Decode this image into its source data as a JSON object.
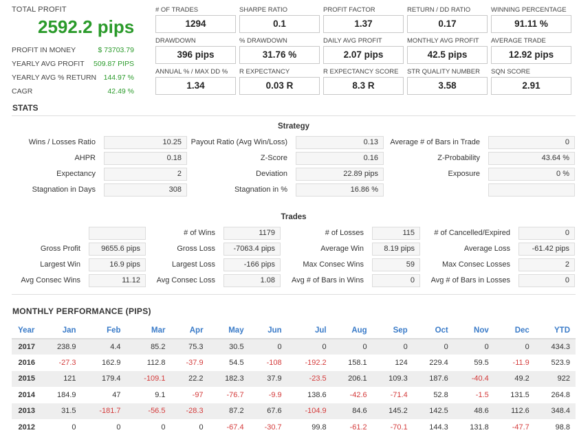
{
  "summary": {
    "total_label": "TOTAL PROFIT",
    "total_value": "2592.2 pips",
    "rows": [
      {
        "label": "PROFIT IN MONEY",
        "value": "$ 73703.79"
      },
      {
        "label": "YEARLY AVG PROFIT",
        "value": "509.87 PIPS"
      },
      {
        "label": "YEARLY AVG % RETURN",
        "value": "144.97 %"
      },
      {
        "label": "CAGR",
        "value": "42.49 %"
      }
    ]
  },
  "metrics": [
    {
      "label": "# OF TRADES",
      "value": "1294"
    },
    {
      "label": "SHARPE RATIO",
      "value": "0.1"
    },
    {
      "label": "PROFIT FACTOR",
      "value": "1.37"
    },
    {
      "label": "RETURN / DD RATIO",
      "value": "0.17"
    },
    {
      "label": "WINNING PERCENTAGE",
      "value": "91.11 %"
    },
    {
      "label": "DRAWDOWN",
      "value": "396 pips"
    },
    {
      "label": "% DRAWDOWN",
      "value": "31.76 %"
    },
    {
      "label": "DAILY AVG PROFIT",
      "value": "2.07 pips"
    },
    {
      "label": "MONTHLY AVG PROFIT",
      "value": "42.5 pips"
    },
    {
      "label": "AVERAGE TRADE",
      "value": "12.92 pips"
    },
    {
      "label": "ANNUAL % / MAX DD %",
      "value": "1.34"
    },
    {
      "label": "R EXPECTANCY",
      "value": "0.03 R"
    },
    {
      "label": "R EXPECTANCY SCORE",
      "value": "8.3 R"
    },
    {
      "label": "STR QUALITY NUMBER",
      "value": "3.58"
    },
    {
      "label": "SQN SCORE",
      "value": "2.91"
    }
  ],
  "stats": {
    "title": "STATS",
    "strategy": {
      "title": "Strategy",
      "rows": [
        [
          {
            "label": "Wins / Losses Ratio",
            "value": "10.25"
          },
          {
            "label": "Payout Ratio (Avg Win/Loss)",
            "value": "0.13"
          },
          {
            "label": "Average # of Bars in Trade",
            "value": "0"
          }
        ],
        [
          {
            "label": "AHPR",
            "value": "0.18"
          },
          {
            "label": "Z-Score",
            "value": "0.16"
          },
          {
            "label": "Z-Probability",
            "value": "43.64 %"
          }
        ],
        [
          {
            "label": "Expectancy",
            "value": "2"
          },
          {
            "label": "Deviation",
            "value": "22.89 pips"
          },
          {
            "label": "Exposure",
            "value": "0 %"
          }
        ],
        [
          {
            "label": "Stagnation in Days",
            "value": "308"
          },
          {
            "label": "Stagnation in %",
            "value": "16.86 %"
          },
          {
            "label": "",
            "value": ""
          }
        ]
      ]
    },
    "trades": {
      "title": "Trades",
      "rows": [
        [
          {
            "label": "",
            "value": ""
          },
          {
            "label": "# of Wins",
            "value": "1179"
          },
          {
            "label": "# of Losses",
            "value": "115"
          },
          {
            "label": "# of Cancelled/Expired",
            "value": "0"
          }
        ],
        [
          {
            "label": "Gross Profit",
            "value": "9655.6 pips"
          },
          {
            "label": "Gross Loss",
            "value": "-7063.4 pips"
          },
          {
            "label": "Average Win",
            "value": "8.19 pips"
          },
          {
            "label": "Average Loss",
            "value": "-61.42 pips"
          }
        ],
        [
          {
            "label": "Largest Win",
            "value": "16.9 pips"
          },
          {
            "label": "Largest Loss",
            "value": "-166 pips"
          },
          {
            "label": "Max Consec Wins",
            "value": "59"
          },
          {
            "label": "Max Consec Losses",
            "value": "2"
          }
        ],
        [
          {
            "label": "Avg Consec Wins",
            "value": "11.12"
          },
          {
            "label": "Avg Consec Loss",
            "value": "1.08"
          },
          {
            "label": "Avg # of Bars in Wins",
            "value": "0"
          },
          {
            "label": "Avg # of Bars in Losses",
            "value": "0"
          }
        ]
      ]
    }
  },
  "monthly": {
    "title": "MONTHLY PERFORMANCE (PIPS)",
    "headers": [
      "Year",
      "Jan",
      "Feb",
      "Mar",
      "Apr",
      "May",
      "Jun",
      "Jul",
      "Aug",
      "Sep",
      "Oct",
      "Nov",
      "Dec",
      "YTD"
    ],
    "rows": [
      [
        "2017",
        "238.9",
        "4.4",
        "85.2",
        "75.3",
        "30.5",
        "0",
        "0",
        "0",
        "0",
        "0",
        "0",
        "0",
        "434.3"
      ],
      [
        "2016",
        "-27.3",
        "162.9",
        "112.8",
        "-37.9",
        "54.5",
        "-108",
        "-192.2",
        "158.1",
        "124",
        "229.4",
        "59.5",
        "-11.9",
        "523.9"
      ],
      [
        "2015",
        "121",
        "179.4",
        "-109.1",
        "22.2",
        "182.3",
        "37.9",
        "-23.5",
        "206.1",
        "109.3",
        "187.6",
        "-40.4",
        "49.2",
        "922"
      ],
      [
        "2014",
        "184.9",
        "47",
        "9.1",
        "-97",
        "-76.7",
        "-9.9",
        "138.6",
        "-42.6",
        "-71.4",
        "52.8",
        "-1.5",
        "131.5",
        "264.8"
      ],
      [
        "2013",
        "31.5",
        "-181.7",
        "-56.5",
        "-28.3",
        "87.2",
        "67.6",
        "-104.9",
        "84.6",
        "145.2",
        "142.5",
        "48.6",
        "112.6",
        "348.4"
      ],
      [
        "2012",
        "0",
        "0",
        "0",
        "0",
        "-67.4",
        "-30.7",
        "99.8",
        "-61.2",
        "-70.1",
        "144.3",
        "131.8",
        "-47.7",
        "98.8"
      ]
    ]
  }
}
